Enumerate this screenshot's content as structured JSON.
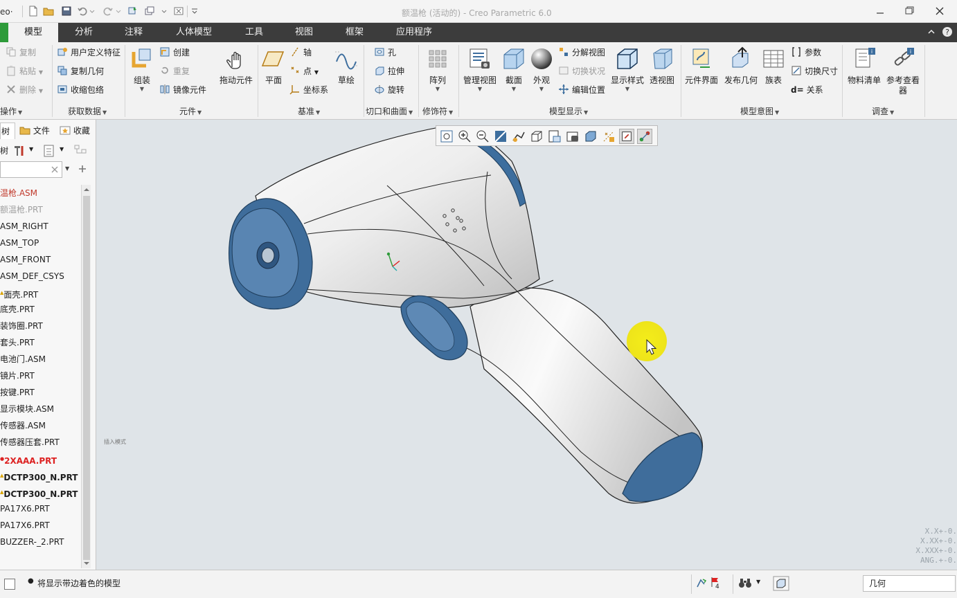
{
  "app": {
    "logo_text": "eo·",
    "window_title": "额温枪 (活动的) - Creo Parametric 6.0"
  },
  "ribbon_tabs": [
    "模型",
    "分析",
    "注释",
    "人体模型",
    "工具",
    "视图",
    "框架",
    "应用程序"
  ],
  "ribbon": {
    "ops": {
      "label": "操作",
      "copy": "复制",
      "paste": "粘贴",
      "delete": "删除"
    },
    "getdata": {
      "label": "获取数据",
      "udf": "用户定义特征",
      "copygeom": "复制几何",
      "shrinkwrap": "收缩包络"
    },
    "component": {
      "label": "元件",
      "assemble": "组装",
      "create": "创建",
      "repeat": "重复",
      "mirror": "镜像元件",
      "drag": "拖动元件"
    },
    "datum": {
      "label": "基准",
      "plane": "平面",
      "axis": "轴",
      "point": "点",
      "csys": "坐标系",
      "sketch": "草绘"
    },
    "cut": {
      "label": "切口和曲面",
      "hole": "孔",
      "extrude": "拉伸",
      "revolve": "旋转"
    },
    "modifier": {
      "label": "修饰符",
      "pattern": "阵列"
    },
    "display": {
      "label": "模型显示",
      "manage_view": "管理视图",
      "section": "截面",
      "appearance": "外观",
      "explode": "分解视图",
      "toggle_state": "切换状况",
      "edit_pos": "编辑位置",
      "display_style": "显示样式",
      "perspective": "透视图"
    },
    "intent": {
      "label": "模型意图",
      "interface": "元件界面",
      "publish": "发布几何",
      "family": "族表",
      "params": "参数",
      "toggle_dim": "切换尺寸",
      "relations": "关系",
      "relations_prefix": "d="
    },
    "investigate": {
      "label": "调查",
      "bom": "物料清单",
      "ref_viewer_1": "参考查看",
      "ref_viewer_2": "器"
    }
  },
  "panel": {
    "tabs": [
      "树",
      "文件",
      "收藏"
    ],
    "tree_label": "树",
    "tree": [
      {
        "name": "温枪.ASM",
        "style": "active",
        "mark": ""
      },
      {
        "name": "额温枪.PRT",
        "style": "dim",
        "mark": ""
      },
      {
        "name": "ASM_RIGHT",
        "style": "",
        "mark": ""
      },
      {
        "name": "ASM_TOP",
        "style": "",
        "mark": ""
      },
      {
        "name": "ASM_FRONT",
        "style": "",
        "mark": ""
      },
      {
        "name": "ASM_DEF_CSYS",
        "style": "",
        "mark": ""
      },
      {
        "name": "面壳.PRT",
        "style": "",
        "mark": "warn"
      },
      {
        "name": "底壳.PRT",
        "style": "",
        "mark": ""
      },
      {
        "name": "装饰圈.PRT",
        "style": "",
        "mark": ""
      },
      {
        "name": "套头.PRT",
        "style": "",
        "mark": ""
      },
      {
        "name": "电池门.ASM",
        "style": "",
        "mark": ""
      },
      {
        "name": "镜片.PRT",
        "style": "",
        "mark": ""
      },
      {
        "name": "按键.PRT",
        "style": "",
        "mark": ""
      },
      {
        "name": "显示模块.ASM",
        "style": "",
        "mark": ""
      },
      {
        "name": "传感器.ASM",
        "style": "",
        "mark": ""
      },
      {
        "name": "传感器压套.PRT",
        "style": "",
        "mark": ""
      },
      {
        "name": "2XAAA.PRT",
        "style": "err",
        "mark": "err"
      },
      {
        "name": "DCTP300_N.PRT",
        "style": "bold",
        "mark": "warn"
      },
      {
        "name": "DCTP300_N.PRT",
        "style": "bold",
        "mark": "warn"
      },
      {
        "name": "PA17X6.PRT",
        "style": "",
        "mark": ""
      },
      {
        "name": "PA17X6.PRT",
        "style": "",
        "mark": ""
      },
      {
        "name": "BUZZER-_2.PRT",
        "style": "",
        "mark": ""
      }
    ]
  },
  "viewport": {
    "insert_mode": "插入模式",
    "tolerances": [
      "X.X+-0.",
      "X.XX+-0.",
      "X.XXX+-0.",
      "ANG.+-0."
    ]
  },
  "status": {
    "message": "将显示带边着色的模型",
    "flag_count": "4",
    "filter": "几何"
  },
  "colors": {
    "accent_blue": "#3d6e9e",
    "tab_bar": "#3c3c3c",
    "brand_green": "#2e9b3a",
    "viewport_bg": "#dfe4e8",
    "cursor_highlight": "#f2ea00"
  }
}
